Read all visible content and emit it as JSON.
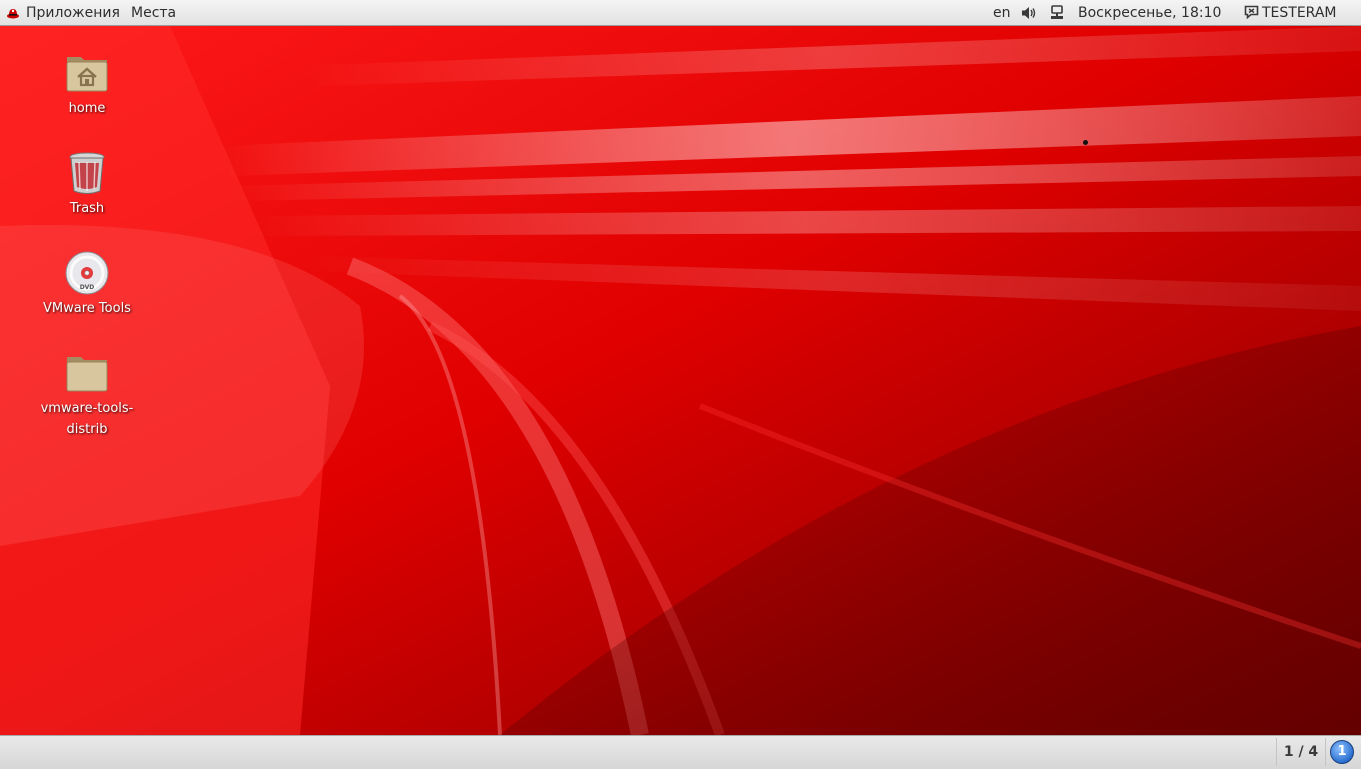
{
  "top_panel": {
    "distro_icon": "redhat-shadowman-icon",
    "applications_menu": "Приложения",
    "places_menu": "Места",
    "keyboard_layout": "en",
    "volume_icon": "speaker-volume-icon",
    "network_icon": "wired-network-icon",
    "clock": "Воскресенье, 18:10",
    "user_icon": "chat-status-icon",
    "user_name": "TESTERAM"
  },
  "desktop": {
    "wallpaper_colors": {
      "base": "#c40000",
      "highlight": "#ff3a3a",
      "shadow": "#6e0000"
    },
    "icons": [
      {
        "label": "home",
        "icon": "home-folder-icon"
      },
      {
        "label": "Trash",
        "icon": "trash-icon"
      },
      {
        "label": "VMware Tools",
        "icon": "dvd-disc-icon"
      },
      {
        "label": "vmware-tools-distrib",
        "label_lines": [
          "vmware-tools-",
          "distrib"
        ],
        "icon": "folder-icon"
      }
    ]
  },
  "bottom_panel": {
    "workspace_indicator": "1 / 4",
    "message_tray_count": "1"
  }
}
